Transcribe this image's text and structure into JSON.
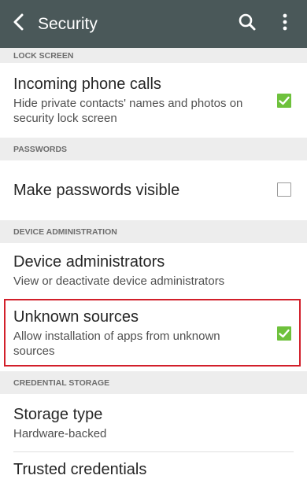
{
  "appbar": {
    "title": "Security",
    "background_color": "#4a5859",
    "back_icon": "chevron-left-icon",
    "search_icon": "search-icon",
    "overflow_icon": "more-vert-icon"
  },
  "sections": {
    "lock_screen": {
      "header": "LOCK SCREEN",
      "incoming_calls": {
        "title": "Incoming phone calls",
        "summary": "Hide private contacts' names and photos on security lock screen",
        "checked": true
      }
    },
    "passwords": {
      "header": "PASSWORDS",
      "make_visible": {
        "title": "Make passwords visible",
        "checked": false
      }
    },
    "device_admin": {
      "header": "DEVICE ADMINISTRATION",
      "device_administrators": {
        "title": "Device administrators",
        "summary": "View or deactivate device administrators"
      },
      "unknown_sources": {
        "title": "Unknown sources",
        "summary": "Allow installation of apps from unknown sources",
        "checked": true,
        "highlighted": true
      }
    },
    "credential_storage": {
      "header": "CREDENTIAL STORAGE",
      "storage_type": {
        "title": "Storage type",
        "summary": "Hardware-backed"
      },
      "trusted_credentials": {
        "title": "Trusted credentials"
      }
    }
  },
  "colors": {
    "checkbox_checked": "#6ec13c",
    "highlight_border": "#d21f2a",
    "section_header_bg": "#ededed"
  }
}
